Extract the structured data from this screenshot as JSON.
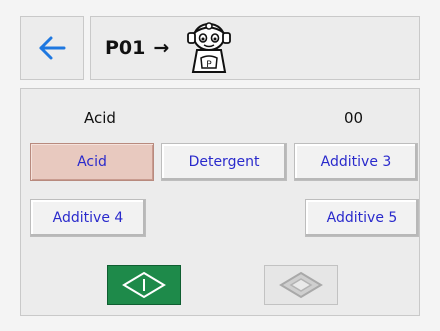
{
  "header": {
    "back_icon": "arrow-left-icon",
    "program": "P01",
    "arrow": "→",
    "mascot_icon": "robot-mascot-icon"
  },
  "status": {
    "agent_label": "Acid",
    "value": "00"
  },
  "buttons": {
    "acid": "Acid",
    "detergent": "Detergent",
    "additive3": "Additive 3",
    "additive4": "Additive 4",
    "additive5": "Additive 5"
  },
  "selected_button": "acid",
  "controls": {
    "start_icon": "start-diamond-icon",
    "stop_icon": "stop-diamond-icon"
  },
  "colors": {
    "accent_blue": "#1f78e0",
    "button_text": "#2a2acc",
    "selected_bg": "#e8c9bf",
    "start_green": "#1e8a4a"
  }
}
